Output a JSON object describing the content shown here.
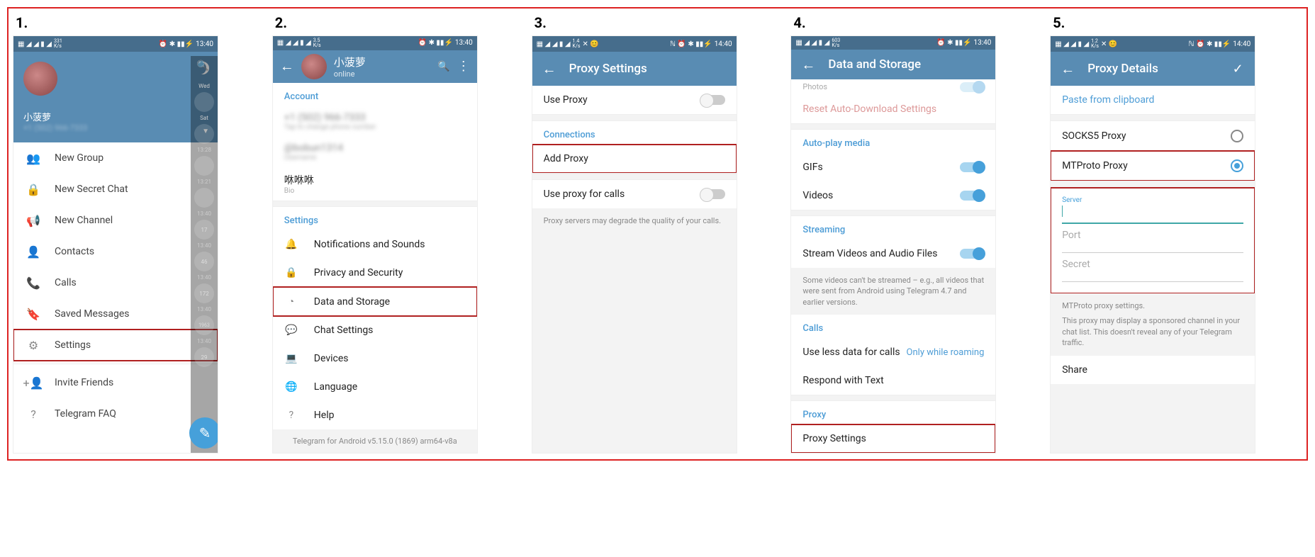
{
  "steps": [
    "1.",
    "2.",
    "3.",
    "4.",
    "5."
  ],
  "status": {
    "time1": "13:40",
    "time2": "13:40",
    "time3": "14:40",
    "time4": "13:40",
    "time5": "14:40",
    "speed1": "331",
    "unit": "K/s",
    "speed2": "3.5",
    "speed3": "1.4",
    "speed4": "603",
    "speed5": "1.2"
  },
  "p1": {
    "name": "小菠萝",
    "menu": {
      "newGroup": "New Group",
      "newSecret": "New Secret Chat",
      "newChannel": "New Channel",
      "contacts": "Contacts",
      "calls": "Calls",
      "saved": "Saved Messages",
      "settings": "Settings",
      "invite": "Invite Friends",
      "faq": "Telegram FAQ"
    },
    "dim": {
      "wed": "Wed",
      "sat": "Sat",
      "t1": "13:28",
      "t2": "13:21",
      "t3": "13:40",
      "t4": "13:40",
      "t5": "13:40",
      "t6": "13:40",
      "t7": "13:40",
      "b1": "17",
      "b2": "46",
      "b3": "172",
      "b4": "1963",
      "b5": "29"
    }
  },
  "p2": {
    "name": "小菠萝",
    "status": "online",
    "accountHead": "Account",
    "phone": "+1 (502) 966-7333",
    "phoneSub": "Tap to change phone number",
    "user": "@bobun1314",
    "userSub": "Username",
    "bio": "咻咻咻",
    "bioSub": "Bio",
    "settingsHead": "Settings",
    "items": {
      "notif": "Notifications and Sounds",
      "privacy": "Privacy and Security",
      "data": "Data and Storage",
      "chat": "Chat Settings",
      "devices": "Devices",
      "lang": "Language",
      "help": "Help"
    },
    "footer": "Telegram for Android v5.15.0 (1869) arm64-v8a"
  },
  "p3": {
    "title": "Proxy Settings",
    "useProxy": "Use Proxy",
    "connHead": "Connections",
    "addProxy": "Add Proxy",
    "useForCalls": "Use proxy for calls",
    "note": "Proxy servers may degrade the quality of your calls."
  },
  "p4": {
    "title": "Data and Storage",
    "photos": "Photos",
    "reset": "Reset Auto-Download Settings",
    "autoplayHead": "Auto-play media",
    "gifs": "GIFs",
    "videos": "Videos",
    "streamHead": "Streaming",
    "stream": "Stream Videos and Audio Files",
    "streamNote": "Some videos can't be streamed – e.g., all videos that were sent from Android using Telegram 4.7 and earlier versions.",
    "callsHead": "Calls",
    "lessData": "Use less data for calls",
    "lessDataVal": "Only while roaming",
    "respond": "Respond with Text",
    "proxyHead": "Proxy",
    "proxySettings": "Proxy Settings"
  },
  "p5": {
    "title": "Proxy Details",
    "paste": "Paste from clipboard",
    "socks": "SOCKS5 Proxy",
    "mtproto": "MTProto Proxy",
    "server": "Server",
    "port": "Port",
    "secret": "Secret",
    "note1": "MTProto proxy settings.",
    "note2": "This proxy may display a sponsored channel in your chat list. This doesn't reveal any of your Telegram traffic.",
    "share": "Share"
  }
}
